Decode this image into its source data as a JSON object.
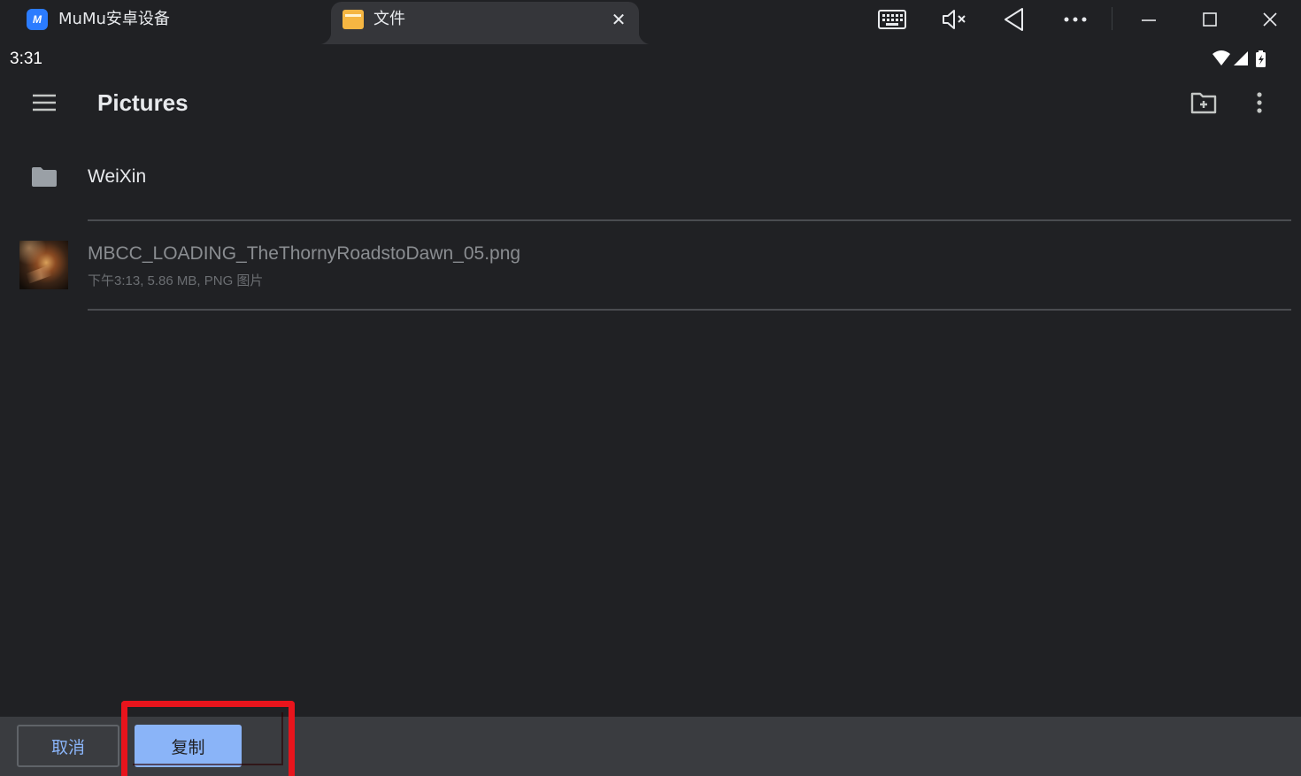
{
  "window": {
    "app_title": "MuMu安卓设备",
    "logo_glyph": "M",
    "tab_label": "文件",
    "tab_icon": "folder-app-icon",
    "toolbar_icons": [
      "keyboard-icon",
      "mute-icon",
      "back-triangle-icon",
      "more-horizontal-icon",
      "minimize-icon",
      "maximize-icon",
      "close-icon"
    ]
  },
  "status_bar": {
    "time": "3:31",
    "icons": [
      "wifi-icon",
      "signal-icon",
      "battery-charging-icon"
    ]
  },
  "app_bar": {
    "title": "Pictures",
    "icons": [
      "menu-icon",
      "new-folder-icon",
      "more-vertical-icon"
    ]
  },
  "list": {
    "items": [
      {
        "type": "folder",
        "name": "WeiXin",
        "icon": "folder-icon"
      },
      {
        "type": "file",
        "name": "MBCC_LOADING_TheThornyRoadstoDawn_05.png",
        "meta": "下午3:13, 5.86 MB, PNG 图片",
        "icon": "image-thumbnail"
      }
    ]
  },
  "actions": {
    "cancel_label": "取消",
    "copy_label": "复制"
  },
  "colors": {
    "background": "#202124",
    "accent": "#8ab4f8",
    "highlight": "#e8141c",
    "bottom_bar": "#3a3c40"
  }
}
